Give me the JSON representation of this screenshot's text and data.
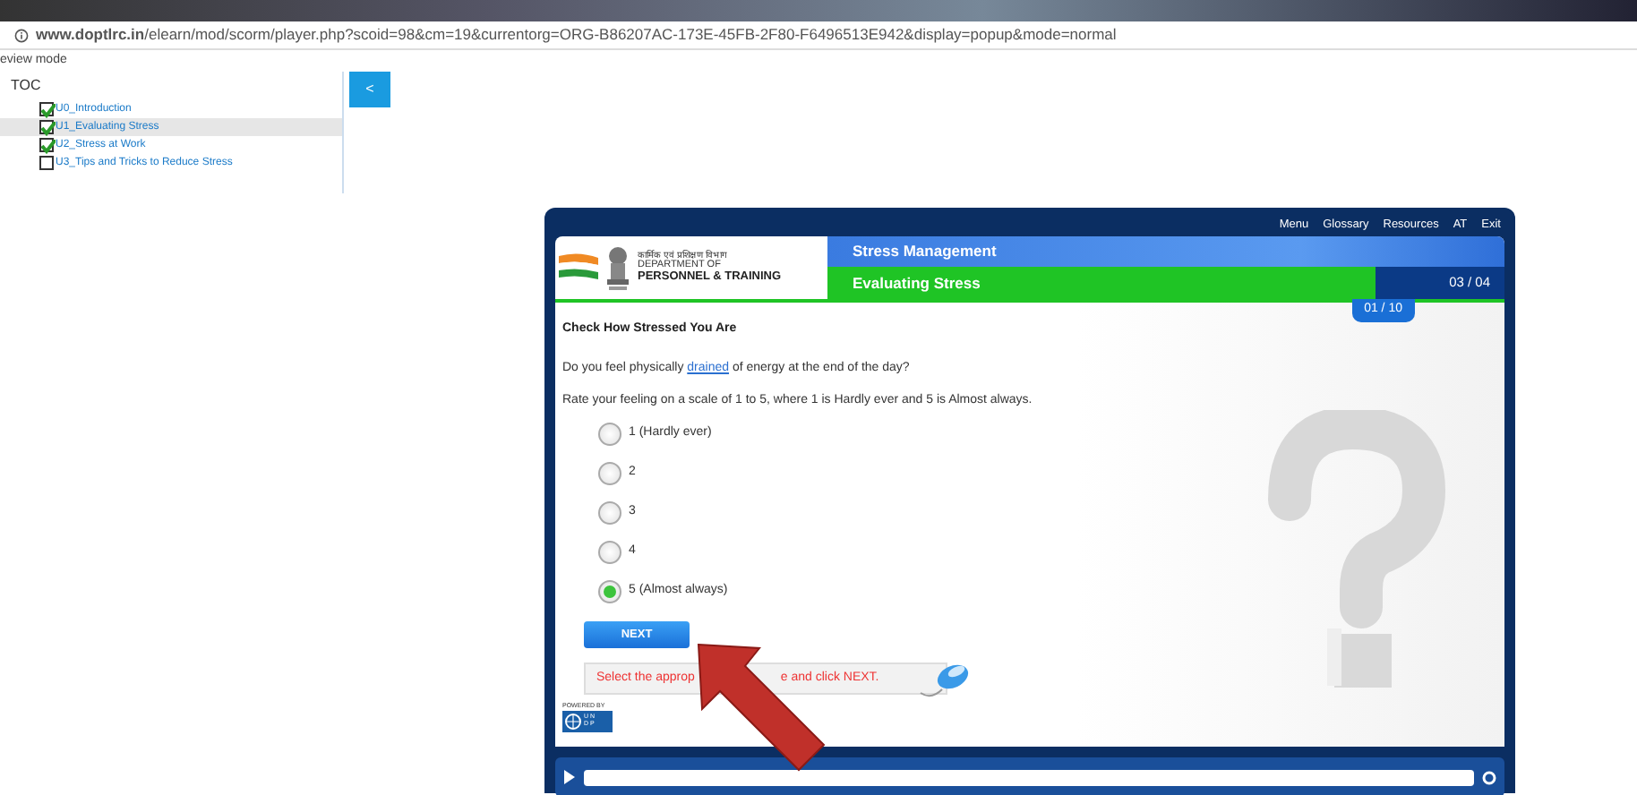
{
  "browser": {
    "address": "**www.doptlrc.in**/elearn/mod/scorm/player.php?scoid=98&cm=19&currentorg=ORG-B86207AC-173E-45FB-2F80-F6496513E942&display=popup&mode=normal"
  },
  "mode_label": "eview mode",
  "toc": {
    "title": "TOC",
    "collapse_button": "<",
    "items": [
      {
        "label": "U0_Introduction",
        "checked": true,
        "selected": false
      },
      {
        "label": "U1_Evaluating Stress",
        "checked": true,
        "selected": true
      },
      {
        "label": "U2_Stress at Work",
        "checked": true,
        "selected": false
      },
      {
        "label": "U3_Tips and Tricks to Reduce Stress",
        "checked": false,
        "selected": false
      }
    ]
  },
  "player": {
    "menu": [
      "Menu",
      "Glossary",
      "Resources",
      "AT",
      "Exit"
    ],
    "logo": {
      "hindi": "कार्मिक एवं प्रशिक्षण विभाग",
      "line1": "DEPARTMENT OF",
      "line2": "PERSONNEL & TRAINING"
    },
    "course": "Stress Management",
    "module": "Evaluating Stress",
    "page": "03 / 04",
    "question_counter": "01 / 10",
    "heading": "Check How Stressed You Are",
    "question": {
      "before": "Do you feel physically",
      "link": "drained",
      "after": "of energy at the end of the day?"
    },
    "instruction": "Rate your feeling on a scale of 1 to 5, where 1 is Hardly ever and 5 is Almost always.",
    "options": [
      {
        "label": "1 (Hardly ever)",
        "selected": false
      },
      {
        "label": "2",
        "selected": false
      },
      {
        "label": "3",
        "selected": false
      },
      {
        "label": "4",
        "selected": false
      },
      {
        "label": "5 (Almost always)",
        "selected": true
      }
    ],
    "next_button": "NEXT",
    "hint_parts": [
      "Select the approp",
      "e and click NEXT."
    ],
    "powered_by": "POWERED BY",
    "undp_letters": [
      "U N",
      "D P"
    ]
  }
}
